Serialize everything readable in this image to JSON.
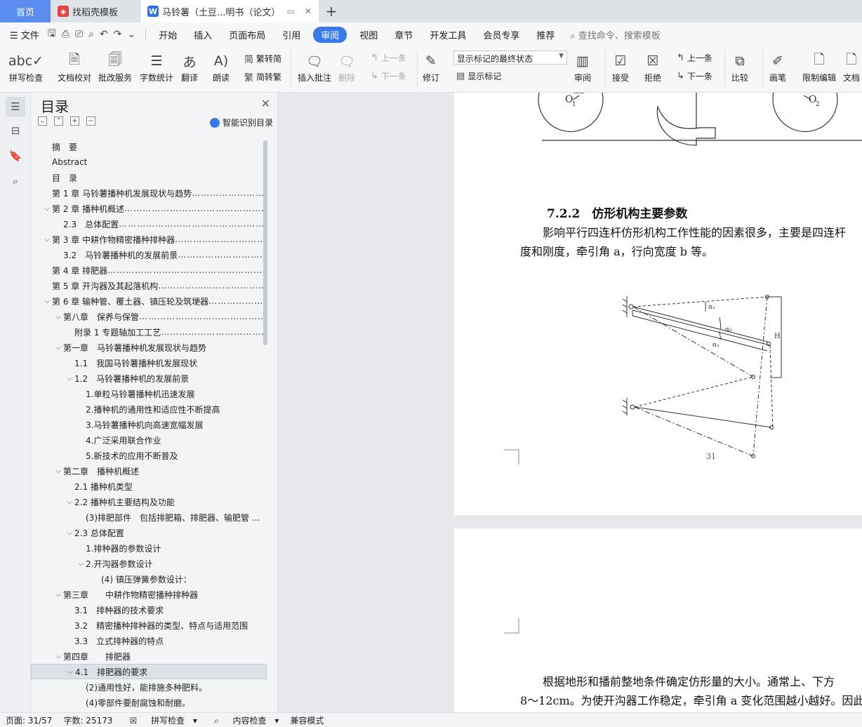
{
  "tabs": {
    "home": "首页",
    "template": "找稻壳模板",
    "doc": "马铃薯（土豆...明书（论文）",
    "plus": "+"
  },
  "menu": {
    "file": "文件",
    "items": [
      "开始",
      "插入",
      "页面布局",
      "引用",
      "审阅",
      "视图",
      "章节",
      "开发工具",
      "会员专享",
      "推荐"
    ],
    "search": "查找命令、搜索模板"
  },
  "ribbon": {
    "spell": "拼写检查",
    "proof": "文档校对",
    "batch": "批改服务",
    "wordcount": "字数统计",
    "translate": "翻译",
    "read": "朗读",
    "trad": "繁转简",
    "simp": "简转繁",
    "comment": "插入批注",
    "delete": "删除",
    "prev": "上一条",
    "next": "下一条",
    "track": "修订",
    "show_state": "显示标记的最终状态",
    "show_marks": "显示标记",
    "review": "审阅",
    "accept": "接受",
    "reject": "拒绝",
    "prev2": "上一条",
    "next2": "下一条",
    "compare": "比较",
    "pen": "画笔",
    "restrict": "限制编辑",
    "doc": "文档"
  },
  "toc": {
    "title": "目录",
    "smart": "智能识别目录",
    "rows": [
      {
        "ind": 0,
        "tw": "",
        "label": "摘　要",
        "dots": false
      },
      {
        "ind": 0,
        "tw": "",
        "label": "Abstract",
        "dots": false
      },
      {
        "ind": 0,
        "tw": "",
        "label": "目　录",
        "dots": false
      },
      {
        "ind": 0,
        "tw": "",
        "label": "第 1 章  马铃薯播种机发展现状与趋势",
        "dots": true
      },
      {
        "ind": 0,
        "tw": "v",
        "label": "第 2 章  播种机概述",
        "dots": true
      },
      {
        "ind": 1,
        "tw": "",
        "label": "2.3　总体配置",
        "dots": true
      },
      {
        "ind": 0,
        "tw": "v",
        "label": "第 3 章  中耕作物精密播种排种器",
        "dots": true
      },
      {
        "ind": 1,
        "tw": "",
        "label": "3.2　马铃薯播种机的发展前景",
        "dots": true
      },
      {
        "ind": 0,
        "tw": "",
        "label": "第 4 章  排肥器",
        "dots": true
      },
      {
        "ind": 0,
        "tw": "",
        "label": "第 5 章  开沟器及其起落机构",
        "dots": true
      },
      {
        "ind": 0,
        "tw": "v",
        "label": "第 6 章  输种管、覆土器、镇压轮及筑埂器",
        "dots": true
      },
      {
        "ind": 1,
        "tw": "v",
        "label": "第八章　保养与保管",
        "dots": true
      },
      {
        "ind": 2,
        "tw": "",
        "label": "附录 1 专题轴加工工艺",
        "dots": true
      },
      {
        "ind": 1,
        "tw": "v",
        "label": "第一章　马铃薯播种机发展现状与趋势",
        "dots": false
      },
      {
        "ind": 2,
        "tw": "",
        "label": "1.1　我国马铃薯播种机发展现状",
        "dots": false
      },
      {
        "ind": 2,
        "tw": "v",
        "label": "1.2　马铃薯播种机的发展前景",
        "dots": false
      },
      {
        "ind": 3,
        "tw": "",
        "label": "1.单粒马铃薯播种机迅速发展",
        "dots": false
      },
      {
        "ind": 3,
        "tw": "",
        "label": "2.播种机的通用性和适应性不断提高",
        "dots": false
      },
      {
        "ind": 3,
        "tw": "",
        "label": "3.马铃薯播种机向高速宽幅发展",
        "dots": false
      },
      {
        "ind": 3,
        "tw": "",
        "label": "4.广泛采用联合作业",
        "dots": false
      },
      {
        "ind": 3,
        "tw": "",
        "label": "5.新技术的应用不断普及",
        "dots": false
      },
      {
        "ind": 1,
        "tw": "v",
        "label": "第二章　播种机概述",
        "dots": false
      },
      {
        "ind": 2,
        "tw": "",
        "label": "2.1  播种机类型",
        "dots": false
      },
      {
        "ind": 2,
        "tw": "v",
        "label": "2.2  播种机主要结构及功能",
        "dots": false
      },
      {
        "ind": 3,
        "tw": "",
        "label": "(3)排肥部件　包括排肥箱、排肥器、输肥管 ...",
        "dots": false
      },
      {
        "ind": 2,
        "tw": "v",
        "label": "2.3  总体配置",
        "dots": false
      },
      {
        "ind": 3,
        "tw": "",
        "label": "1.排种器的参数设计",
        "dots": false
      },
      {
        "ind": 3,
        "tw": "v",
        "label": "2.开沟器参数设计",
        "dots": false
      },
      {
        "ind": 4,
        "tw": "",
        "label": "(4)  镇压弹簧参数设计：",
        "dots": false
      },
      {
        "ind": 1,
        "tw": "v",
        "label": "第三章　　中耕作物精密播种排种器",
        "dots": false
      },
      {
        "ind": 2,
        "tw": "",
        "label": "3.1　排种器的技术要求",
        "dots": false
      },
      {
        "ind": 2,
        "tw": "",
        "label": "3.2　精密播种排种器的类型、特点与适用范围",
        "dots": false
      },
      {
        "ind": 2,
        "tw": "",
        "label": "3.3　立式排种器的特点",
        "dots": false
      },
      {
        "ind": 1,
        "tw": "v",
        "label": "第四章　　排肥器",
        "dots": false
      },
      {
        "ind": 2,
        "tw": "v",
        "label": "4.1　排肥器的要求",
        "dots": false,
        "sel": true
      },
      {
        "ind": 3,
        "tw": "",
        "label": "(2)通用性好，能排施多种肥料。",
        "dots": false
      },
      {
        "ind": 3,
        "tw": "",
        "label": "(4)零部件要耐腐蚀和耐磨。",
        "dots": false
      }
    ]
  },
  "doc": {
    "heading": "7.2.2　仿形机构主要参数",
    "para1_line1": "影响平行四连杆仿形机构工作性能的因素很多，主要是四连杆",
    "para1_line2": "度和刚度，牵引角 a，行向宽度 b 等。",
    "page_number": "31",
    "fig_labels": {
      "o1": "O",
      "o1sub": "1",
      "o2": "O",
      "o2sub": "2",
      "a2": "α₂",
      "a0": "α₀",
      "a1": "α₁",
      "H": "H"
    },
    "para2_line1": "根据地形和播前整地条件确定仿形量的大小。通常上、下方",
    "para2_line2": "8～12cm。为使开沟器工作稳定，牵引角 a 变化范围越小越好。因此"
  },
  "status": {
    "page": "页面: 31/57",
    "words": "字数: 25173",
    "spell": "拼写检查",
    "content": "内容检查",
    "mode": "兼容模式"
  },
  "colors": {
    "accent": "#3b79e8",
    "home_tab": "#5b8def"
  }
}
